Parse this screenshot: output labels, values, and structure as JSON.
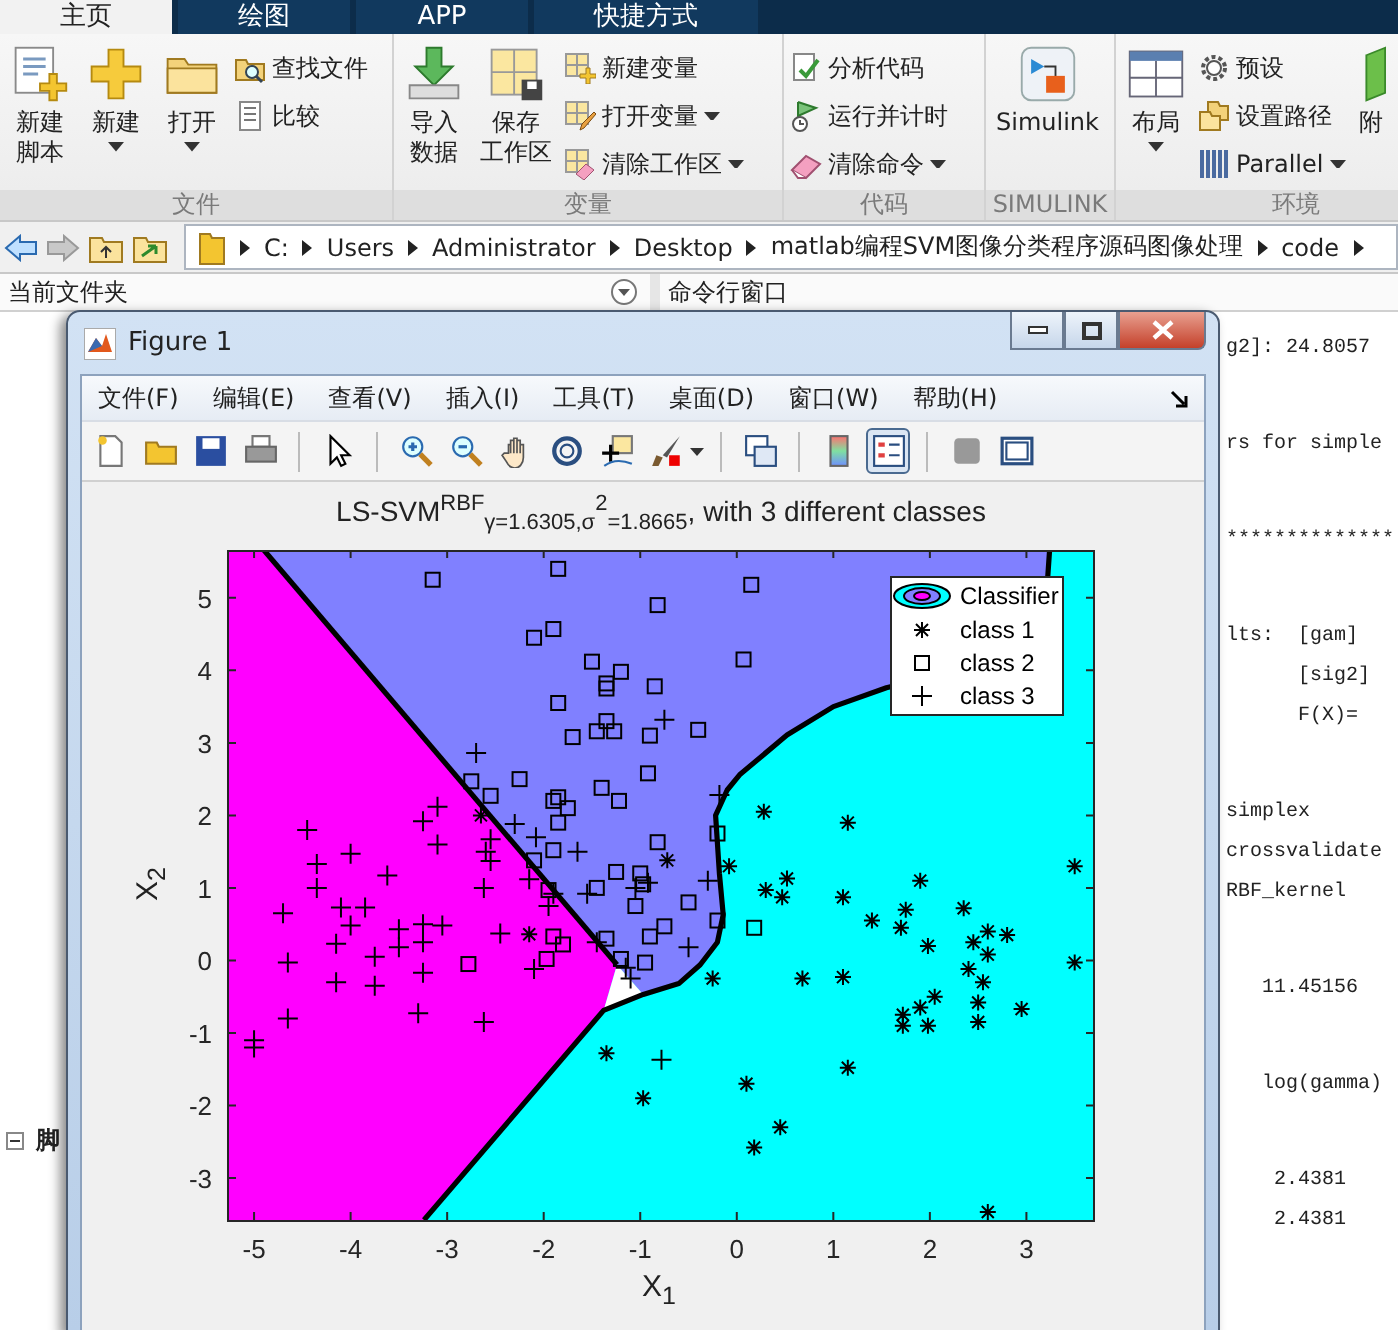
{
  "app_tabs": [
    {
      "label": "主页",
      "selected": true
    },
    {
      "label": "绘图",
      "selected": false
    },
    {
      "label": "APP",
      "selected": false
    },
    {
      "label": "快捷方式",
      "selected": false
    }
  ],
  "ribbon": {
    "groups": [
      {
        "title": "文件",
        "items": [
          {
            "kind": "large",
            "lines": [
              "新建",
              "脚本"
            ],
            "dropdown": false
          },
          {
            "kind": "large",
            "lines": [
              "新建"
            ],
            "dropdown": true
          },
          {
            "kind": "large",
            "lines": [
              "打开"
            ],
            "dropdown": true
          },
          {
            "kind": "stack",
            "items": [
              {
                "label": "查找文件",
                "dropdown": false
              },
              {
                "label": "比较",
                "dropdown": false
              }
            ]
          }
        ]
      },
      {
        "title": "变量",
        "items": [
          {
            "kind": "large",
            "lines": [
              "导入",
              "数据"
            ],
            "dropdown": false
          },
          {
            "kind": "large",
            "lines": [
              "保存",
              "工作区"
            ],
            "dropdown": false
          },
          {
            "kind": "stack",
            "items": [
              {
                "label": "新建变量",
                "dropdown": false
              },
              {
                "label": "打开变量",
                "dropdown": true
              },
              {
                "label": "清除工作区",
                "dropdown": true
              }
            ]
          }
        ]
      },
      {
        "title": "代码",
        "items": [
          {
            "kind": "stack",
            "items": [
              {
                "label": "分析代码",
                "dropdown": false
              },
              {
                "label": "运行并计时",
                "dropdown": false
              },
              {
                "label": "清除命令",
                "dropdown": true
              }
            ]
          }
        ]
      },
      {
        "title": "SIMULINK",
        "items": [
          {
            "kind": "large",
            "lines": [
              "Simulink"
            ],
            "dropdown": false
          }
        ]
      },
      {
        "title": "环境",
        "items": [
          {
            "kind": "large",
            "lines": [
              "布局"
            ],
            "dropdown": true
          },
          {
            "kind": "stack",
            "items": [
              {
                "label": "预设",
                "dropdown": false
              },
              {
                "label": "设置路径",
                "dropdown": false
              },
              {
                "label": "Parallel",
                "dropdown": true
              }
            ]
          },
          {
            "kind": "large",
            "lines": [
              "附"
            ],
            "dropdown": false
          }
        ]
      }
    ]
  },
  "address": {
    "path": [
      "C:",
      "Users",
      "Administrator",
      "Desktop",
      "matlab编程SVM图像分类程序源码图像处理",
      "code"
    ]
  },
  "current_folder": {
    "title": "当前文件夹",
    "tree": [
      {
        "label": "脚",
        "expanded": true
      }
    ]
  },
  "command_window": {
    "title": "命令行窗口",
    "blocks": [
      [
        "g2]: 24.8057"
      ],
      [
        "rs for simple"
      ],
      [
        "**************"
      ],
      [
        "lts:  [gam]",
        "      [sig2]",
        "      F(X)="
      ],
      [
        "simplex",
        "crossvalidate",
        "RBF_kernel"
      ],
      [
        "   11.45156"
      ],
      [
        "   log(gamma)"
      ],
      [
        "    2.4381",
        "    2.4381"
      ]
    ]
  },
  "figure": {
    "title": "Figure 1",
    "menu": [
      "文件(F)",
      "编辑(E)",
      "查看(V)",
      "插入(I)",
      "工具(T)",
      "桌面(D)",
      "窗口(W)",
      "帮助(H)"
    ],
    "toolbar_groups": [
      [
        {
          "pressed": false,
          "dropdown": false
        },
        {
          "pressed": false,
          "dropdown": false
        },
        {
          "pressed": false,
          "dropdown": false
        },
        {
          "pressed": false,
          "dropdown": false
        }
      ],
      [
        {
          "pressed": false,
          "dropdown": false
        }
      ],
      [
        {
          "pressed": false,
          "dropdown": false
        },
        {
          "pressed": false,
          "dropdown": false
        },
        {
          "pressed": false,
          "dropdown": false
        },
        {
          "pressed": false,
          "dropdown": false
        },
        {
          "pressed": false,
          "dropdown": false
        },
        {
          "pressed": false,
          "dropdown": true
        }
      ],
      [
        {
          "pressed": false,
          "dropdown": false
        }
      ],
      [
        {
          "pressed": false,
          "dropdown": false
        },
        {
          "pressed": true,
          "dropdown": false
        }
      ],
      [
        {
          "pressed": false,
          "dropdown": false
        },
        {
          "pressed": false,
          "dropdown": false
        }
      ]
    ],
    "chart_data": {
      "type": "scatter",
      "title": "LS-SVM$^{RBF}$$_{γ=1.6305,σ}$$^{2}$$_{=1.8665}$, with 3 different classes",
      "xlabel": "X$_{1}$",
      "ylabel": "X$_{2}$",
      "xlim": [
        -5.27,
        3.7
      ],
      "ylim": [
        -3.58,
        5.66
      ],
      "xticks": [
        {
          "value": -5,
          "label": "-5"
        },
        {
          "value": -4,
          "label": "-4"
        },
        {
          "value": -3,
          "label": "-3"
        },
        {
          "value": -2,
          "label": "-2"
        },
        {
          "value": -1,
          "label": "-1"
        },
        {
          "value": 0,
          "label": "0"
        },
        {
          "value": 1,
          "label": "1"
        },
        {
          "value": 2,
          "label": "2"
        },
        {
          "value": 3,
          "label": "3"
        }
      ],
      "yticks": [
        {
          "value": -3,
          "label": "-3"
        },
        {
          "value": -2,
          "label": "-2"
        },
        {
          "value": -1,
          "label": "-1"
        },
        {
          "value": 0,
          "label": "0"
        },
        {
          "value": 1,
          "label": "1"
        },
        {
          "value": 2,
          "label": "2"
        },
        {
          "value": 3,
          "label": "3"
        },
        {
          "value": 4,
          "label": "4"
        },
        {
          "value": 5,
          "label": "5"
        }
      ],
      "series": [
        {
          "name": "class 1",
          "color": "#000000",
          "x": [
            0.28,
            1.15,
            -0.08,
            0.3,
            0.47,
            0.52,
            1.1,
            1.4,
            1.7,
            1.75,
            1.9,
            2.35,
            1.98,
            2.45,
            2.6,
            2.8,
            2.6,
            2.4,
            2.55,
            3.5,
            3.5,
            2.95,
            2.5,
            2.5,
            2.05,
            1.9,
            1.72,
            1.72,
            1.98,
            1.1,
            0.68,
            -0.25,
            1.15,
            0.1,
            0.45,
            0.18,
            -0.97,
            -1.35,
            2.6,
            -0.72,
            -2.15,
            -2.65
          ],
          "values": [
            2.05,
            1.9,
            1.3,
            0.97,
            0.87,
            1.13,
            0.87,
            0.55,
            0.45,
            0.7,
            1.1,
            0.72,
            0.2,
            0.25,
            0.4,
            0.35,
            0.08,
            -0.12,
            -0.3,
            1.3,
            -0.03,
            -0.67,
            -0.58,
            -0.85,
            -0.5,
            -0.65,
            -0.75,
            -0.9,
            -0.9,
            -0.23,
            -0.25,
            -0.25,
            -1.48,
            -1.7,
            -2.3,
            -2.58,
            -1.9,
            -1.28,
            -3.47,
            1.38,
            0.36,
            2.0
          ]
        },
        {
          "name": "class 2",
          "color": "#000000",
          "marker": "square",
          "x": [
            -3.15,
            -1.85,
            0.15,
            -0.82,
            -2.1,
            -1.9,
            -1.5,
            -1.2,
            0.07,
            -1.35,
            -1.35,
            -0.85,
            -1.85,
            -1.35,
            -1.7,
            -1.45,
            -1.27,
            -0.9,
            -0.4,
            -0.92,
            -2.25,
            -2.75,
            -2.55,
            -1.4,
            -1.22,
            -1.9,
            -1.85,
            -1.75,
            -1.85,
            -0.82,
            -1.9,
            -2.1,
            -1.25,
            -1.0,
            -1.45,
            -0.97,
            -1.95,
            -0.5,
            -1.05,
            -0.75,
            -0.2,
            0.18,
            -0.9,
            -1.35,
            -1.9,
            -1.8,
            -1.97,
            -2.78,
            -1.2,
            -0.95,
            -0.2
          ],
          "values": [
            5.25,
            5.4,
            5.18,
            4.9,
            4.45,
            4.57,
            4.12,
            3.98,
            4.15,
            3.82,
            3.75,
            3.78,
            3.55,
            3.3,
            3.08,
            3.16,
            3.16,
            3.1,
            3.18,
            2.58,
            2.5,
            2.47,
            2.27,
            2.38,
            2.2,
            2.2,
            2.25,
            2.1,
            1.9,
            1.63,
            1.52,
            1.38,
            1.22,
            1.2,
            1.0,
            1.05,
            0.97,
            0.8,
            0.75,
            0.47,
            0.55,
            0.45,
            0.33,
            0.3,
            0.33,
            0.22,
            0.02,
            -0.05,
            0.02,
            -0.03,
            1.75
          ]
        },
        {
          "name": "class 3",
          "color": "#000000",
          "marker": "cross",
          "x": [
            -4.45,
            -4.35,
            -4.35,
            -4.0,
            -4.1,
            -3.85,
            -4.0,
            -4.15,
            -3.62,
            -3.5,
            -3.5,
            -3.25,
            -3.25,
            -3.75,
            -3.75,
            -3.25,
            -4.15,
            -4.7,
            -4.65,
            -4.65,
            -5.0,
            -5.0,
            -3.3,
            -2.62,
            -3.05,
            -3.1,
            -3.25,
            -3.1,
            -2.6,
            -2.55,
            -2.55,
            -2.62,
            -2.45,
            -2.3,
            -2.08,
            -2.15,
            -1.9,
            -1.95,
            -2.1,
            -2.7,
            -1.65,
            -1.55,
            -1.05,
            -0.92,
            -0.75,
            -0.5,
            -0.3,
            -0.18,
            -1.45,
            -1.15,
            -1.1,
            -0.78
          ],
          "values": [
            1.8,
            1.33,
            1.0,
            1.47,
            0.73,
            0.73,
            0.48,
            0.23,
            1.17,
            0.43,
            0.18,
            0.5,
            0.25,
            0.05,
            -0.35,
            -0.17,
            -0.3,
            0.65,
            -0.03,
            -0.8,
            -1.1,
            -1.2,
            -0.73,
            -0.85,
            0.48,
            2.12,
            1.92,
            1.6,
            1.5,
            1.37,
            1.67,
            1.0,
            0.37,
            1.88,
            1.7,
            1.12,
            0.92,
            0.75,
            -0.12,
            2.86,
            1.5,
            0.92,
            1.0,
            1.07,
            3.32,
            0.18,
            1.1,
            2.28,
            0.25,
            -0.1,
            -0.25,
            -1.37
          ]
        }
      ],
      "legend": "upper right",
      "annotations": [
        {
          "text": "Classifier"
        }
      ]
    }
  }
}
